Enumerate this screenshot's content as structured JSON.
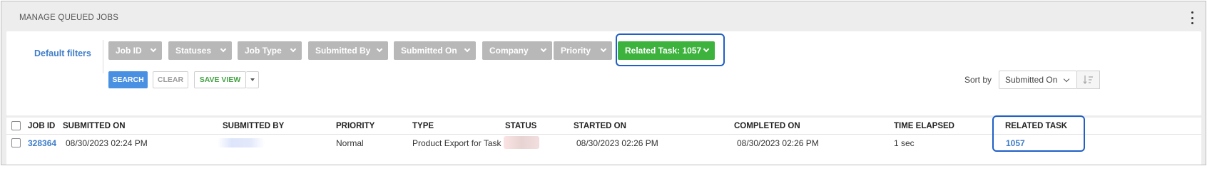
{
  "panel": {
    "title": "MANAGE QUEUED JOBS"
  },
  "filters": {
    "default_label": "Default filters",
    "chips": [
      {
        "label": "Job ID"
      },
      {
        "label": "Statuses"
      },
      {
        "label": "Job Type"
      },
      {
        "label": "Submitted By"
      },
      {
        "label": "Submitted On"
      },
      {
        "label": "Company"
      },
      {
        "label": "Priority"
      },
      {
        "label": "Related Task: 1057",
        "active": true
      }
    ],
    "active_color": "#3db33d",
    "inactive_color": "#b8b8b8"
  },
  "actions": {
    "search": "SEARCH",
    "clear": "CLEAR",
    "save_view": "SAVE VIEW"
  },
  "sort": {
    "label": "Sort by",
    "value": "Submitted On"
  },
  "table": {
    "headers": {
      "job_id": "JOB ID",
      "submitted_on": "SUBMITTED ON",
      "submitted_by": "SUBMITTED BY",
      "priority": "PRIORITY",
      "type": "TYPE",
      "status": "STATUS",
      "started_on": "STARTED ON",
      "completed_on": "COMPLETED ON",
      "time_elapsed": "TIME ELAPSED",
      "related_task": "RELATED TASK"
    },
    "rows": [
      {
        "job_id": "328364",
        "submitted_on": "08/30/2023 02:24 PM",
        "priority": "Normal",
        "type": "Product Export for Task",
        "started_on": "08/30/2023 02:26 PM",
        "completed_on": "08/30/2023 02:26 PM",
        "time_elapsed": "1 sec",
        "related_task": "1057"
      }
    ]
  },
  "colors": {
    "accent": "#3d7cc9",
    "highlight_border": "#1f5fc6",
    "search_button": "#4a90e2"
  }
}
